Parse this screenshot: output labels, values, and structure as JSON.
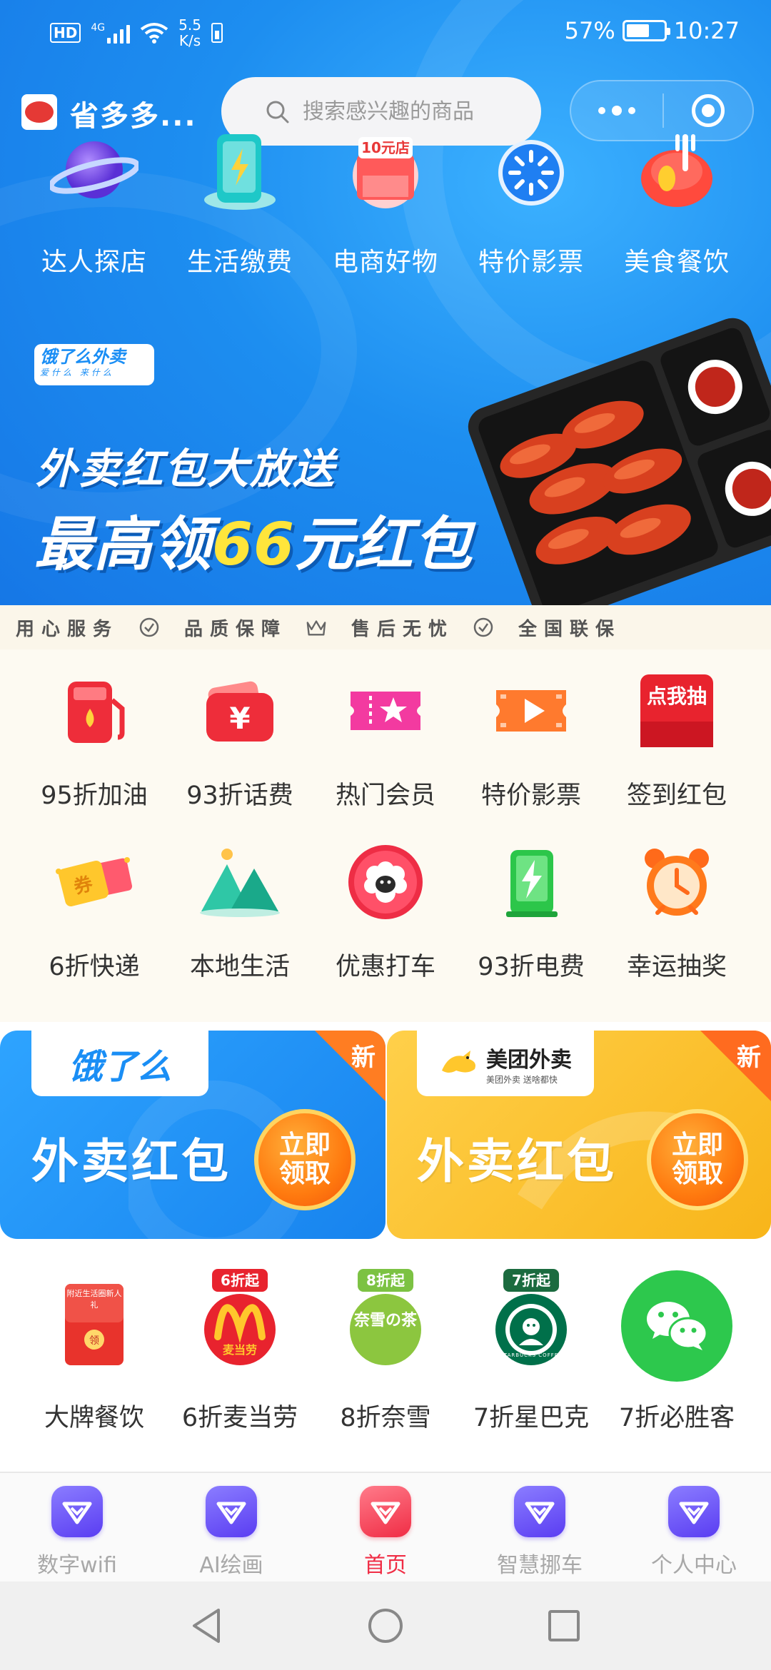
{
  "status_bar": {
    "network": "HD",
    "signal_type": "4G",
    "speed_value": "5.5",
    "speed_unit": "K/s",
    "battery_percent": "57%",
    "time": "10:27"
  },
  "header": {
    "app_name": "省多多...",
    "search_placeholder": "搜索感兴趣的商品"
  },
  "top_categories": [
    {
      "label": "达人探店",
      "icon": "planet-icon"
    },
    {
      "label": "生活缴费",
      "icon": "phone-bolt-icon"
    },
    {
      "label": "电商好物",
      "icon": "shop-icon",
      "icon_text": "10元店"
    },
    {
      "label": "特价影票",
      "icon": "burst-icon"
    },
    {
      "label": "美食餐饮",
      "icon": "food-icon"
    }
  ],
  "banner": {
    "brand": "饿了么外卖",
    "brand_slogan": "爱什么 来什么",
    "line1": "外卖红包大放送",
    "line2_prefix": "最高领",
    "line2_highlight": "66",
    "line2_suffix": "元红包"
  },
  "features": [
    "用心服务",
    "品质保障",
    "售后无忧",
    "全国联保"
  ],
  "services": [
    [
      {
        "label": "95折加油",
        "icon": "fuel-icon"
      },
      {
        "label": "93折话费",
        "icon": "yuan-wallet-icon"
      },
      {
        "label": "热门会员",
        "icon": "star-ticket-icon"
      },
      {
        "label": "特价影票",
        "icon": "movie-ticket-icon"
      },
      {
        "label": "签到红包",
        "icon": "red-packet-icon",
        "icon_text": "点我抽"
      }
    ],
    [
      {
        "label": "6折快递",
        "icon": "coupon-icon",
        "icon_text": "券"
      },
      {
        "label": "本地生活",
        "icon": "mountain-icon"
      },
      {
        "label": "优惠打车",
        "icon": "sheep-icon"
      },
      {
        "label": "93折电费",
        "icon": "electric-icon"
      },
      {
        "label": "幸运抽奖",
        "icon": "alarm-clock-icon"
      }
    ]
  ],
  "cards": [
    {
      "brand": "饿了么",
      "badge": "新",
      "title": "外卖红包",
      "button": "立即领取"
    },
    {
      "brand": "美团外卖",
      "brand_sub": "美团外卖 送啥都快",
      "badge": "新",
      "title": "外卖红包",
      "button": "立即领取"
    }
  ],
  "brands": [
    {
      "label": "大牌餐饮",
      "icon": "red-envelope-icon",
      "badge": "",
      "icon_text": "附近生活圈新人礼",
      "icon_text2": "领"
    },
    {
      "label": "6折麦当劳",
      "icon": "mcdonalds-icon",
      "badge": "6折起",
      "icon_text": "麦当劳"
    },
    {
      "label": "8折奈雪",
      "icon": "naixue-icon",
      "badge": "8折起",
      "icon_text": "奈雪の茶"
    },
    {
      "label": "7折星巴克",
      "icon": "starbucks-icon",
      "badge": "7折起",
      "icon_text": "STARBUCKS COFFEE"
    },
    {
      "label": "7折必胜客",
      "icon": "wechat-icon",
      "badge": ""
    }
  ],
  "tabbar": [
    {
      "label": "数字wifi",
      "active": false
    },
    {
      "label": "AI绘画",
      "active": false
    },
    {
      "label": "首页",
      "active": true
    },
    {
      "label": "智慧挪车",
      "active": false
    },
    {
      "label": "个人中心",
      "active": false
    }
  ],
  "colors": {
    "primary_blue": "#1d8ef0",
    "accent_red": "#f02d45",
    "meituan_yellow": "#ffc730",
    "banner_highlight": "#ffe53b"
  }
}
